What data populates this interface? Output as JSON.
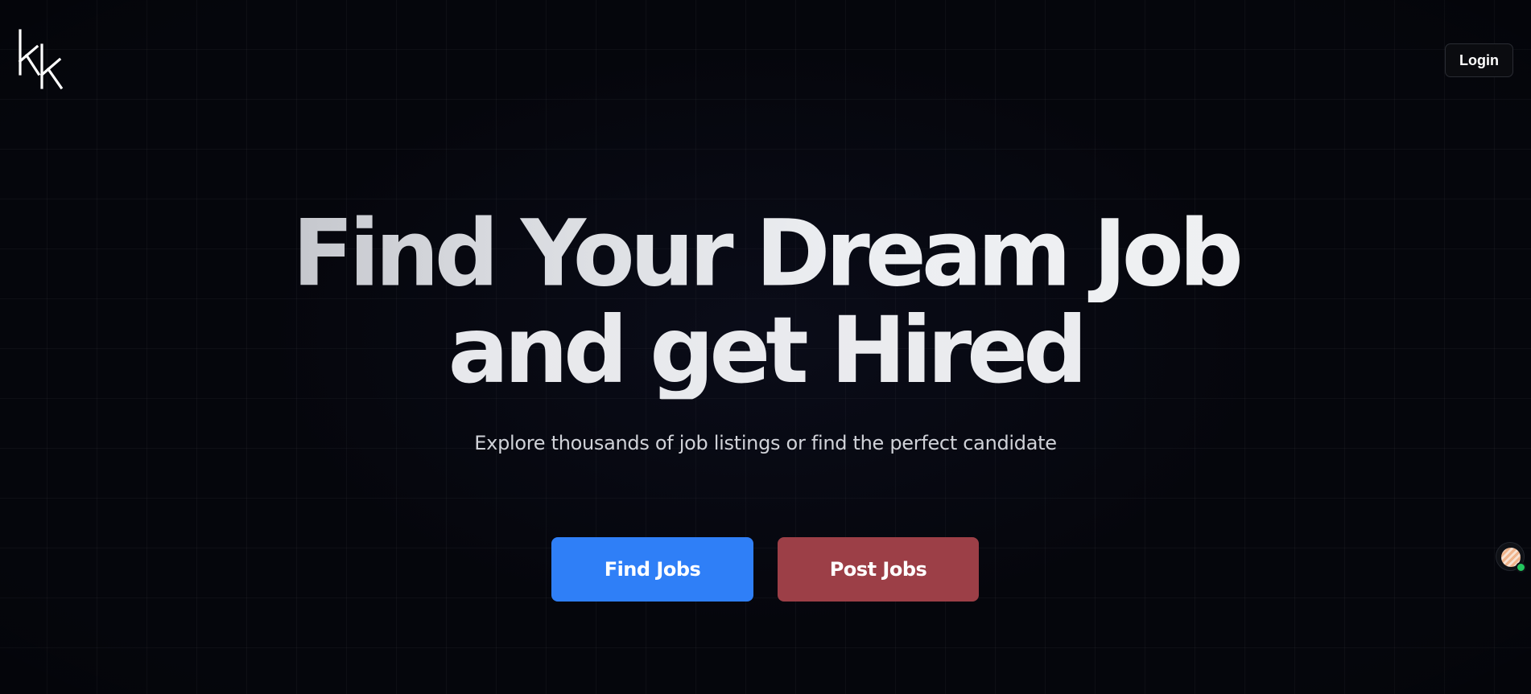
{
  "header": {
    "logo_icon": "kk-logo-icon",
    "login_label": "Login"
  },
  "hero": {
    "title_line1": "Find Your Dream Job",
    "title_line2": "and get Hired",
    "subtitle": "Explore thousands of job listings or find the perfect candidate"
  },
  "actions": {
    "find_jobs_label": "Find Jobs",
    "post_jobs_label": "Post Jobs"
  },
  "chat_widget": {
    "icon": "chat-avatar-icon",
    "status": "online"
  },
  "colors": {
    "background": "#05060c",
    "find_jobs": "#2f7ff7",
    "post_jobs": "#9c3f47",
    "online_status": "#22c55e"
  }
}
